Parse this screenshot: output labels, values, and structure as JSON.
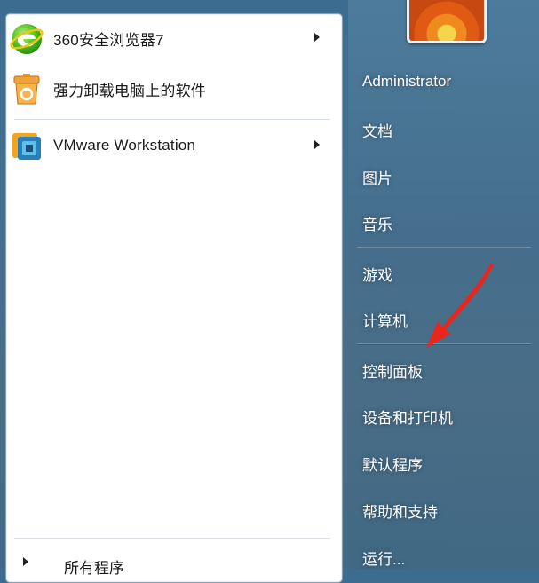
{
  "left_panel": {
    "programs": [
      {
        "label": "360安全浏览器7",
        "icon": "browser-360-icon",
        "has_submenu": true
      },
      {
        "label": "强力卸载电脑上的软件",
        "icon": "uninstaller-icon",
        "has_submenu": false
      },
      {
        "label": "VMware Workstation",
        "icon": "vmware-icon",
        "has_submenu": true
      }
    ],
    "all_programs_label": "所有程序"
  },
  "right_panel": {
    "user_name": "Administrator",
    "items": [
      {
        "label": "文档"
      },
      {
        "label": "图片"
      },
      {
        "label": "音乐"
      },
      {
        "label": "游戏"
      },
      {
        "label": "计算机"
      },
      {
        "label": "控制面板"
      },
      {
        "label": "设备和打印机"
      },
      {
        "label": "默认程序"
      },
      {
        "label": "帮助和支持"
      },
      {
        "label": "运行..."
      }
    ]
  },
  "annotation": {
    "color": "#e8261b",
    "points_to": "控制面板"
  }
}
